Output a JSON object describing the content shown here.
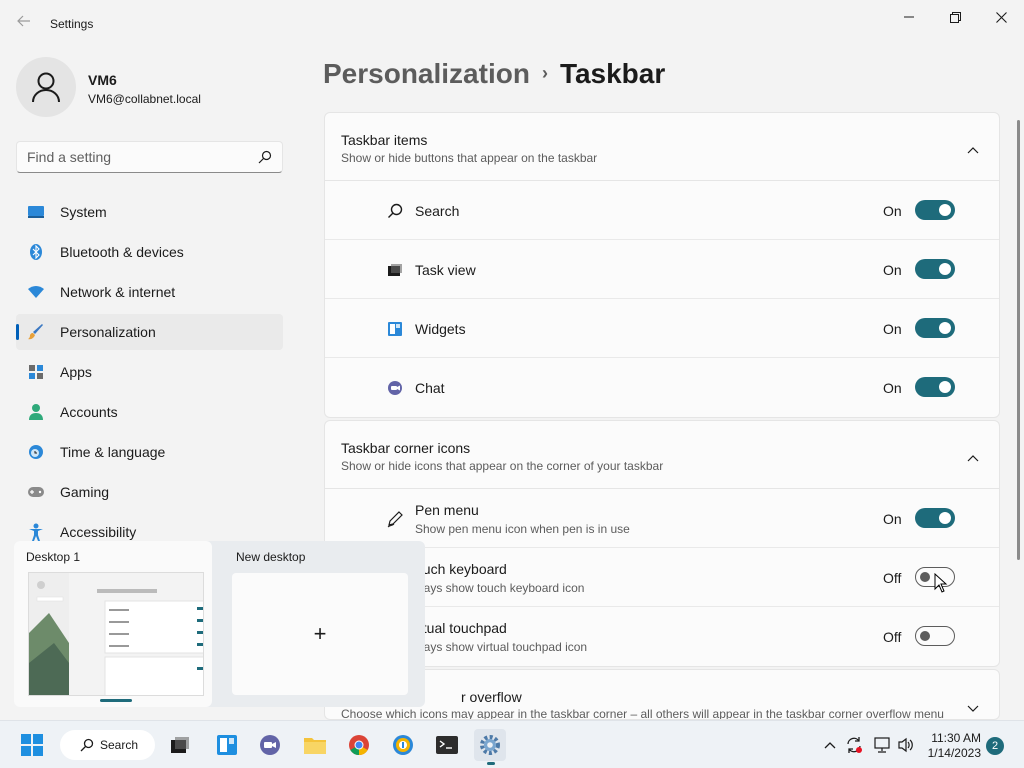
{
  "window": {
    "title": "Settings"
  },
  "user": {
    "name": "VM6",
    "email": "VM6@collabnet.local"
  },
  "search": {
    "placeholder": "Find a setting"
  },
  "sidebar": {
    "items": [
      {
        "label": "System",
        "icon": "system-icon"
      },
      {
        "label": "Bluetooth & devices",
        "icon": "bluetooth-icon"
      },
      {
        "label": "Network & internet",
        "icon": "wifi-icon"
      },
      {
        "label": "Personalization",
        "icon": "brush-icon",
        "active": true
      },
      {
        "label": "Apps",
        "icon": "apps-icon"
      },
      {
        "label": "Accounts",
        "icon": "accounts-icon"
      },
      {
        "label": "Time & language",
        "icon": "clock-icon"
      },
      {
        "label": "Gaming",
        "icon": "gamepad-icon"
      },
      {
        "label": "Accessibility",
        "icon": "accessibility-icon"
      }
    ]
  },
  "breadcrumb": {
    "parent": "Personalization",
    "separator": "›",
    "current": "Taskbar"
  },
  "taskbar_items": {
    "title": "Taskbar items",
    "subtitle": "Show or hide buttons that appear on the taskbar",
    "rows": [
      {
        "label": "Search",
        "state": "On",
        "on": true,
        "icon": "search-icon"
      },
      {
        "label": "Task view",
        "state": "On",
        "on": true,
        "icon": "task-view-icon"
      },
      {
        "label": "Widgets",
        "state": "On",
        "on": true,
        "icon": "widgets-icon"
      },
      {
        "label": "Chat",
        "state": "On",
        "on": true,
        "icon": "chat-icon"
      }
    ]
  },
  "corner_icons": {
    "title": "Taskbar corner icons",
    "subtitle": "Show or hide icons that appear on the corner of your taskbar",
    "rows": [
      {
        "label": "Pen menu",
        "desc": "Show pen menu icon when pen is in use",
        "state": "On",
        "on": true,
        "icon": "pen-icon"
      },
      {
        "label": "ouch keyboard",
        "desc": "ways show touch keyboard icon",
        "state": "Off",
        "on": false
      },
      {
        "label": "irtual touchpad",
        "desc": "ways show virtual touchpad icon",
        "state": "Off",
        "on": false
      }
    ]
  },
  "overflow": {
    "title": "r overflow",
    "subtitle": "Choose which icons may appear in the taskbar corner – all others will appear in the taskbar corner overflow menu"
  },
  "taskview": {
    "desktop1": "Desktop 1",
    "new_desktop": "New desktop",
    "plus": "+"
  },
  "taskbar": {
    "search_label": "Search",
    "time": "11:30 AM",
    "date": "1/14/2023",
    "notifications": "2"
  },
  "colors": {
    "accent": "#1e6b7b",
    "active_nav": "#005fb8"
  }
}
